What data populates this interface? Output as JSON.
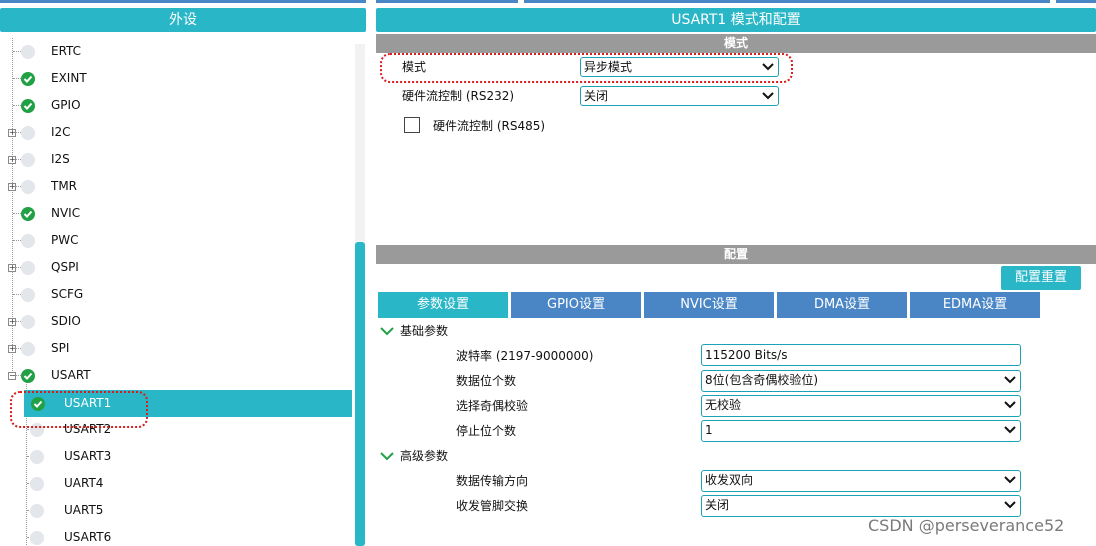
{
  "left_panel": {
    "title": "外设",
    "items": [
      {
        "label": "ERTC",
        "status": "inactive",
        "expandable": false
      },
      {
        "label": "EXINT",
        "status": "active",
        "expandable": false
      },
      {
        "label": "GPIO",
        "status": "active",
        "expandable": false
      },
      {
        "label": "I2C",
        "status": "inactive",
        "expandable": true
      },
      {
        "label": "I2S",
        "status": "inactive",
        "expandable": true
      },
      {
        "label": "TMR",
        "status": "inactive",
        "expandable": true
      },
      {
        "label": "NVIC",
        "status": "active",
        "expandable": false
      },
      {
        "label": "PWC",
        "status": "inactive",
        "expandable": false
      },
      {
        "label": "QSPI",
        "status": "inactive",
        "expandable": true
      },
      {
        "label": "SCFG",
        "status": "inactive",
        "expandable": false
      },
      {
        "label": "SDIO",
        "status": "inactive",
        "expandable": true
      },
      {
        "label": "SPI",
        "status": "inactive",
        "expandable": true
      },
      {
        "label": "USART",
        "status": "active",
        "expandable": true,
        "expanded": true
      },
      {
        "label": "USART1",
        "status": "active",
        "selected": true,
        "child": true
      },
      {
        "label": "USART2",
        "status": "inactive",
        "child": true
      },
      {
        "label": "USART3",
        "status": "inactive",
        "child": true
      },
      {
        "label": "UART4",
        "status": "inactive",
        "child": true
      },
      {
        "label": "UART5",
        "status": "inactive",
        "child": true
      },
      {
        "label": "USART6",
        "status": "inactive",
        "child": true
      }
    ]
  },
  "right_panel": {
    "title": "USART1 模式和配置",
    "mode_section": {
      "title": "模式",
      "mode_label": "模式",
      "mode_value": "异步模式",
      "flow_rs232_label": "硬件流控制 (RS232)",
      "flow_rs232_value": "关闭",
      "flow_rs485_label": "硬件流控制 (RS485)",
      "flow_rs485_checked": false
    },
    "config_section": {
      "title": "配置",
      "reset_button": "配置重置",
      "tabs": [
        "参数设置",
        "GPIO设置",
        "NVIC设置",
        "DMA设置",
        "EDMA设置"
      ],
      "active_tab": 0,
      "basic_group": {
        "title": "基础参数",
        "baud_label": "波特率 (2197-9000000)",
        "baud_value": "115200 Bits/s",
        "data_bits_label": "数据位个数",
        "data_bits_value": "8位(包含奇偶校验位)",
        "parity_label": "选择奇偶校验",
        "parity_value": "无校验",
        "stop_bits_label": "停止位个数",
        "stop_bits_value": "1"
      },
      "advanced_group": {
        "title": "高级参数",
        "direction_label": "数据传输方向",
        "direction_value": "收发双向",
        "swap_label": "收发管脚交换",
        "swap_value": "关闭"
      }
    }
  },
  "watermark": "CSDN @perseverance52",
  "colors": {
    "header": "#29b6c6",
    "tab": "#4a86c6",
    "section_bar": "#9a9a9a",
    "active_dot": "#22a045",
    "highlight": "#d91c1c"
  }
}
